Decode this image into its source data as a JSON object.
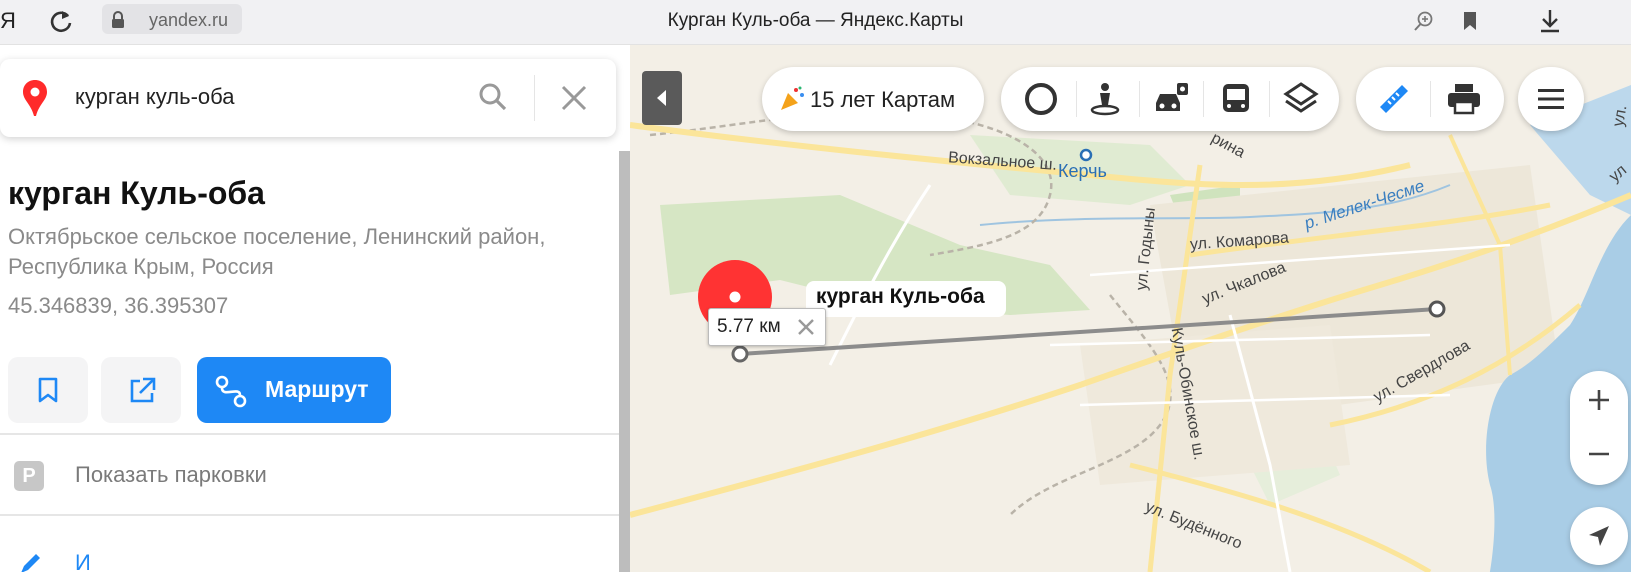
{
  "browser": {
    "logo": "Я",
    "url": "yandex.ru",
    "tab_title": "Курган Куль-оба — Яндекс.Карты",
    "icons": [
      "reload-icon",
      "lock-icon",
      "zoom-in-page-icon",
      "bookmark-icon",
      "download-icon"
    ]
  },
  "search": {
    "query": "курган куль-оба",
    "icons": [
      "yandex-pin-icon",
      "search-icon",
      "close-icon"
    ]
  },
  "place": {
    "title": "курган Куль-оба",
    "address": "Октябрьское сельское поселение, Ленинский район, Республика Крым, Россия",
    "coordinates": "45.346839, 36.395307",
    "route_label": "Маршрут",
    "parking_badge": "P",
    "parking_label": "Показать парковки",
    "next_item_label": "И"
  },
  "map": {
    "anniversary_label": "15 лет Картам",
    "pin_label": "курган Куль-оба",
    "distance_label": "5.77 км",
    "street_labels": {
      "vokzalnoe": "Вокзальное ш.",
      "kerch": "Керчь",
      "melek": "р. Мелек-Чесме",
      "komarova": "ул. Комарова",
      "chkalova": "ул. Чкалова",
      "godyny": "ул. Годыны",
      "kulobinskoe": "Куль-Обинское ш.",
      "sverdlova": "ул. Свердлова",
      "budennogo": "ул. Будённого",
      "rina": "рина",
      "ul_top1": "ул.",
      "ul_top2": "ул.",
      "ul_right": "ул"
    },
    "controls": [
      "panorama-icon",
      "street-view-icon",
      "traffic-icon",
      "transit-icon",
      "layers-icon",
      "ruler-icon",
      "print-icon",
      "menu-icon",
      "zoom-in-icon",
      "zoom-out-icon",
      "geolocation-icon",
      "collapse-panel-icon"
    ],
    "colors": {
      "pin": "#ff3333",
      "route_button": "#1e88f5",
      "ruler_active": "#1e88f5",
      "water": "#a9cde6",
      "greenery": "#d6e6c4",
      "road": "#fbe59a",
      "measure_line": "#8c8c8c"
    }
  }
}
